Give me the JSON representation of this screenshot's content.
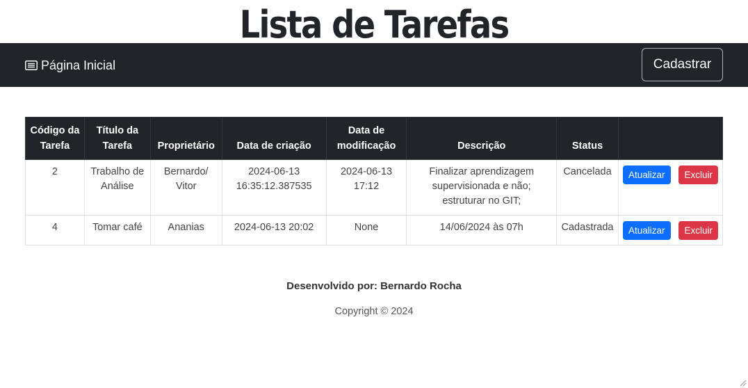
{
  "header": {
    "title": "Lista de Tarefas"
  },
  "navbar": {
    "home_label": "Página Inicial",
    "home_icon": "list-icon",
    "register_label": "Cadastrar"
  },
  "table": {
    "headers": [
      "Código da Tarefa",
      "Título da Tarefa",
      "Proprietário",
      "Data de criação",
      "Data de modificação",
      "Descrição",
      "Status",
      ""
    ],
    "rows": [
      {
        "codigo": "2",
        "titulo": "Trabalho de Análise",
        "proprietario": "Bernardo/ Vitor",
        "criacao": "2024-06-13 16:35:12.387535",
        "modificacao": "2024-06-13 17:12",
        "descricao": "Finalizar aprendizagem supervisionada e não; estruturar no GIT;",
        "status": "Cancelada",
        "update_label": "Atualizar",
        "delete_label": "Excluir"
      },
      {
        "codigo": "4",
        "titulo": "Tomar café",
        "proprietario": "Ananias",
        "criacao": "2024-06-13 20:02",
        "modificacao": "None",
        "descricao": "14/06/2024 às 07h",
        "status": "Cadastrada",
        "update_label": "Atualizar",
        "delete_label": "Excluir"
      }
    ]
  },
  "footer": {
    "developer": "Desenvolvido por: Bernardo Rocha",
    "copyright": "Copyright © 2024"
  },
  "colors": {
    "navbar_bg": "#212529",
    "primary": "#0d6efd",
    "danger": "#dc3545"
  }
}
